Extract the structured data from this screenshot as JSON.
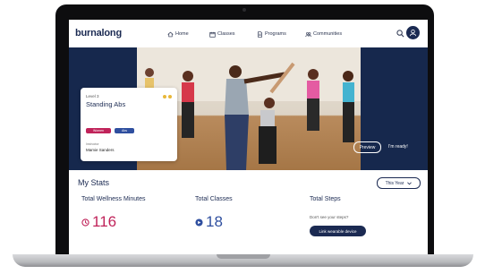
{
  "app": {
    "logo": "burnalong"
  },
  "nav": {
    "items": [
      {
        "label": "Home",
        "icon": "home-icon"
      },
      {
        "label": "Classes",
        "icon": "calendar-icon"
      },
      {
        "label": "Programs",
        "icon": "document-icon"
      },
      {
        "label": "Communities",
        "icon": "people-icon"
      }
    ]
  },
  "hero": {
    "level": "Level 3",
    "title": "Standing Abs",
    "tags": [
      "Women",
      "Abs"
    ],
    "instructor_label": "Instructor",
    "instructor": "Mamie Sanders",
    "preview_label": "Preview",
    "ready_label": "I'm ready!"
  },
  "stats": {
    "title": "My Stats",
    "period": "This Year",
    "wellness_label": "Total Wellness Minutes",
    "wellness_value": "116",
    "classes_label": "Total Classes",
    "classes_value": "18",
    "steps_label": "Total Steps",
    "steps_note": "Don't see your steps?",
    "link_button": "Link wearable device"
  },
  "colors": {
    "navy": "#1b2a52",
    "pink": "#c0235a",
    "blue": "#2f4f9f",
    "hero_bg": "#16284d"
  }
}
